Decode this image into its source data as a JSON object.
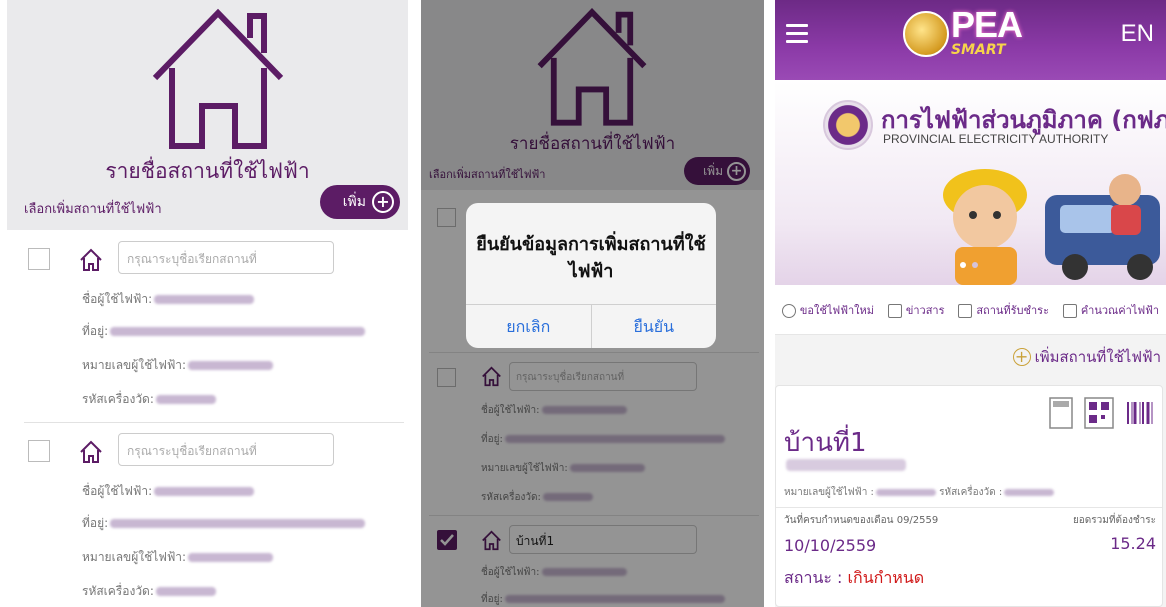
{
  "panel1": {
    "title": "รายชื่อสถานที่ใช้ไฟฟ้า",
    "add_hint": "เลือกเพิ่มสถานที่ใช้ไฟฟ้า",
    "add_button": "เพิ่ม",
    "add_icon": "+",
    "items": [
      {
        "placeholder": "กรุณาระบุชื่อเรียกสถานที่",
        "user_label": "ชื่อผู้ใช้ไฟฟ้า:",
        "address_label": "ที่อยู่:",
        "account_label": "หมายเลขผู้ใช้ไฟฟ้า:",
        "meter_label": "รหัสเครื่องวัด:"
      },
      {
        "placeholder": "กรุณาระบุชื่อเรียกสถานที่",
        "user_label": "ชื่อผู้ใช้ไฟฟ้า:",
        "address_label": "ที่อยู่:",
        "account_label": "หมายเลขผู้ใช้ไฟฟ้า:",
        "meter_label": "รหัสเครื่องวัด:"
      }
    ]
  },
  "panel2": {
    "title": "รายชื่อสถานที่ใช้ไฟฟ้า",
    "add_hint": "เลือกเพิ่มสถานที่ใช้ไฟฟ้า",
    "add_button": "เพิ่ม",
    "add_icon": "+",
    "dialog": {
      "message": "ยืนยันข้อมูลการเพิ่มสถานที่ใช้ไฟฟ้า",
      "cancel": "ยกเลิก",
      "confirm": "ยืนยัน"
    },
    "items": [
      {
        "placeholder": "กรุณาระบุชื่อเรียกสถานที่",
        "user_label": "ชื่อผู้ใช้ไฟฟ้า:",
        "address_label": "ที่อยู่:",
        "account_label": "หมายเลขผู้ใช้ไฟฟ้า:",
        "meter_label": "รหัสเครื่องวัด:"
      },
      {
        "value": "บ้านที่1",
        "checked": true,
        "user_label": "ชื่อผู้ใช้ไฟฟ้า:",
        "address_label": "ที่อยู่:"
      }
    ]
  },
  "panel3": {
    "menu_icon": "hamburger-icon",
    "language": "EN",
    "app_logo": "PEA",
    "app_logo_sub": "SMART",
    "org_th": "การไฟฟ้าส่วนภูมิภาค (กฟภ)",
    "org_en": "PROVINCIAL ELECTRICITY AUTHORITY",
    "menu": [
      {
        "icon": "bulb-icon",
        "label": "ขอใช้ไฟฟ้าใหม่"
      },
      {
        "icon": "news-icon",
        "label": "ข่าวสาร"
      },
      {
        "icon": "counter-icon",
        "label": "สถานที่รับชำระ"
      },
      {
        "icon": "calculator-icon",
        "label": "คำนวณค่าไฟฟ้า"
      }
    ],
    "add_place": "เพิ่มสถานที่ใช้ไฟฟ้า",
    "card": {
      "title": "บ้านที่1",
      "account_label": "หมายเลขผู้ใช้ไฟฟ้า :",
      "meter_label": "รหัสเครื่องวัด :",
      "due_label": "วันที่ครบกำหนดของเดือน 09/2559",
      "total_label": "ยอดรวมที่ต้องชำระ",
      "due_date": "10/10/2559",
      "amount": "15.24",
      "status_label": "สถานะ : ",
      "status_value": "เกินกำหนด"
    },
    "colors": {
      "brand": "#6b2a88",
      "overdue": "#d01818"
    }
  }
}
